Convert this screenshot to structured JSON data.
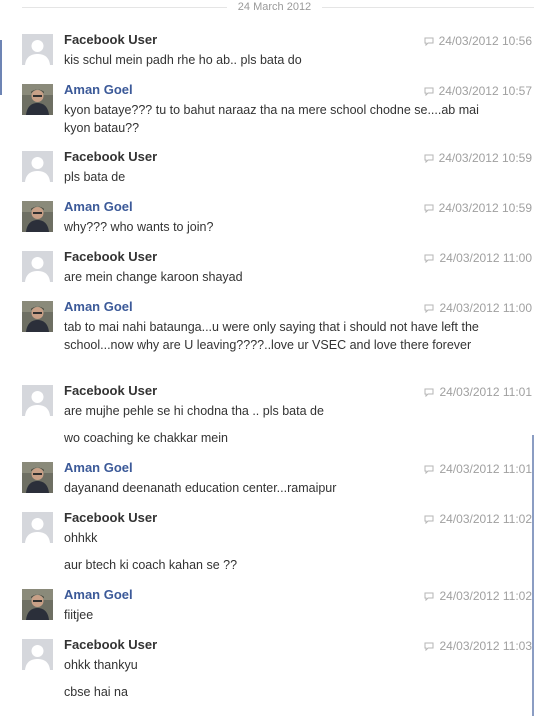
{
  "date_separator": "24 March 2012",
  "messages": [
    {
      "sender": "Facebook User",
      "time": "24/03/2012 10:56",
      "lines": [
        "kis schul mein padh rhe ho ab.. pls bata do"
      ]
    },
    {
      "sender": "Aman Goel",
      "time": "24/03/2012 10:57",
      "lines": [
        "kyon bataye??? tu to bahut naraaz tha na mere school chodne se....ab mai kyon batau??"
      ]
    },
    {
      "sender": "Facebook User",
      "time": "24/03/2012 10:59",
      "lines": [
        "pls bata de"
      ]
    },
    {
      "sender": "Aman Goel",
      "time": "24/03/2012 10:59",
      "lines": [
        "why??? who wants to join?"
      ]
    },
    {
      "sender": "Facebook User",
      "time": "24/03/2012 11:00",
      "lines": [
        "are mein change karoon shayad"
      ]
    },
    {
      "sender": "Aman Goel",
      "time": "24/03/2012 11:00",
      "lines": [
        "tab to mai nahi bataunga...u were only saying that i should not have left the school...now why are U leaving????..love ur VSEC and love there forever"
      ]
    },
    {
      "sender": "Facebook User",
      "time": "24/03/2012 11:01",
      "lines": [
        "are mujhe pehle se hi  chodna tha .. pls bata de",
        "wo coaching ke chakkar mein"
      ]
    },
    {
      "sender": "Aman Goel",
      "time": "24/03/2012 11:01",
      "lines": [
        "dayanand deenanath education center...ramaipur"
      ]
    },
    {
      "sender": "Facebook User",
      "time": "24/03/2012 11:02",
      "lines": [
        "ohhkk",
        "aur btech ki coach kahan se ??"
      ]
    },
    {
      "sender": "Aman Goel",
      "time": "24/03/2012 11:02",
      "lines": [
        "fiitjee"
      ]
    },
    {
      "sender": "Facebook User",
      "time": "24/03/2012 11:03",
      "lines": [
        "ohkk thankyu",
        "cbse hai na"
      ]
    }
  ],
  "colors": {
    "link_name": "#3b5998",
    "text": "#333333",
    "meta": "#a0a0a0"
  },
  "icons": {
    "anonymous_avatar": "silhouette-avatar-icon",
    "message_source": "chat-bubble-icon"
  }
}
